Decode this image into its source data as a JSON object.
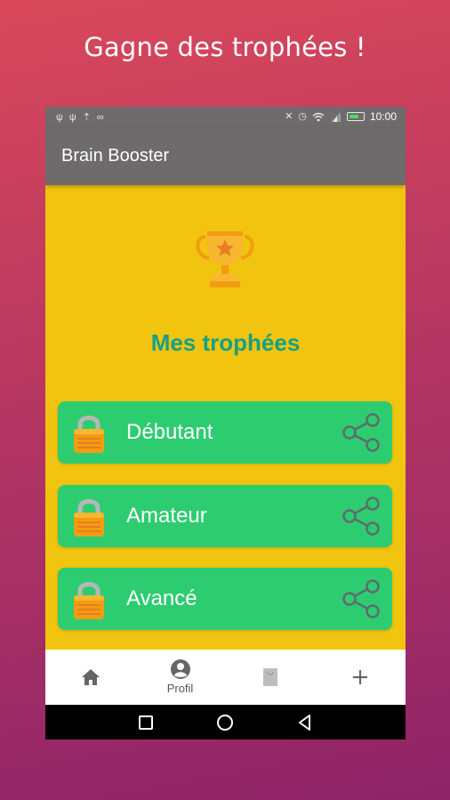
{
  "headline": "Gagne des trophées !",
  "status_bar": {
    "left_icons": [
      "usb-icon",
      "usb-icon",
      "upload-icon",
      "voicemail-icon"
    ],
    "right_icons": [
      "mute-icon",
      "alarm-icon",
      "wifi-icon",
      "signal-icon",
      "battery-icon"
    ],
    "time": "10:00"
  },
  "app_bar": {
    "title": "Brain Booster"
  },
  "main": {
    "section_title": "Mes trophées",
    "trophies": [
      {
        "label": "Débutant",
        "locked": true
      },
      {
        "label": "Amateur",
        "locked": true
      },
      {
        "label": "Avancé",
        "locked": true
      }
    ]
  },
  "bottom_nav": {
    "items": [
      {
        "icon": "home-icon",
        "label": ""
      },
      {
        "icon": "account-circle-icon",
        "label": "Profil"
      },
      {
        "icon": "shopping-bag-icon",
        "label": ""
      },
      {
        "icon": "plus-icon",
        "label": ""
      }
    ]
  },
  "colors": {
    "background_top": "#d9485a",
    "background_bottom": "#8e2468",
    "app_bar": "#6d6b6b",
    "content": "#f1c40f",
    "card": "#2ecc71",
    "section_title": "#16a085"
  }
}
